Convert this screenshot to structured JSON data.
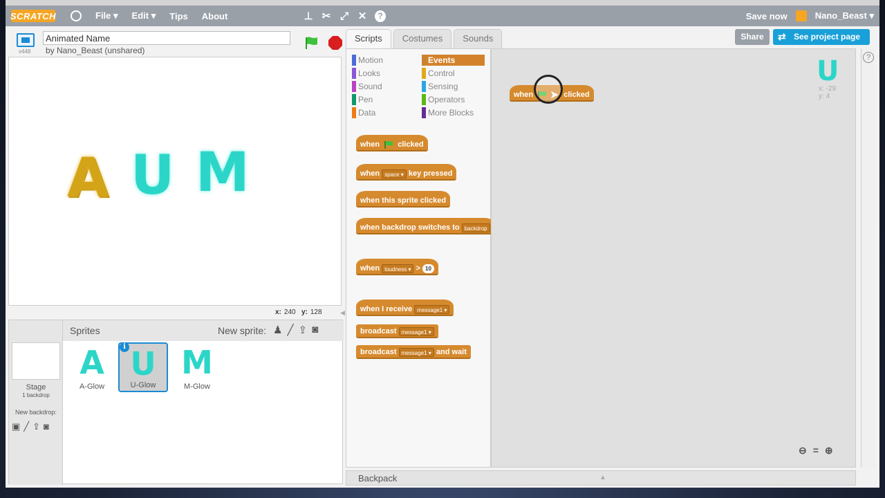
{
  "colors": {
    "menubar": "#9aa0a8",
    "block_orange": "#d68a2e",
    "accent_blue": "#1aa0d8",
    "glow_cyan": "#2bd6c8",
    "glow_gold": "#d4a418"
  },
  "menubar": {
    "logo": "SCRATCH",
    "items": [
      "File ▾",
      "Edit ▾",
      "Tips",
      "About"
    ],
    "tools": [
      "duplicate-icon",
      "delete-icon",
      "grow-icon",
      "shrink-icon",
      "help-icon"
    ],
    "save_now": "Save now",
    "user": "Nano_Beast ▾"
  },
  "stage_header": {
    "version": "v448",
    "project_title": "Animated Name",
    "byline": "by Nano_Beast (unshared)"
  },
  "stage": {
    "letters": [
      "A",
      "U",
      "M"
    ],
    "coords_x_label": "x:",
    "coords_x": "240",
    "coords_y_label": "y:",
    "coords_y": "128"
  },
  "sprites_pane": {
    "title": "Sprites",
    "new_sprite": "New sprite:",
    "stage_label": "Stage",
    "stage_sub": "1 backdrop",
    "new_backdrop": "New backdrop:",
    "sprites": [
      {
        "glyph": "A",
        "name": "A-Glow"
      },
      {
        "glyph": "U",
        "name": "U-Glow",
        "selected": true
      },
      {
        "glyph": "M",
        "name": "M-Glow"
      }
    ]
  },
  "tabs": [
    "Scripts",
    "Costumes",
    "Sounds"
  ],
  "share": "Share",
  "see_project": "See project page",
  "categories": [
    {
      "label": "Motion",
      "color": "#4a6cd4"
    },
    {
      "label": "Looks",
      "color": "#8a55d7"
    },
    {
      "label": "Sound",
      "color": "#bb42c3"
    },
    {
      "label": "Pen",
      "color": "#0e9a6c"
    },
    {
      "label": "Data",
      "color": "#ee7d16"
    },
    {
      "label": "Events",
      "color": "#c88330",
      "active": true
    },
    {
      "label": "Control",
      "color": "#e1a91a"
    },
    {
      "label": "Sensing",
      "color": "#2ca5e2"
    },
    {
      "label": "Operators",
      "color": "#5cb712"
    },
    {
      "label": "More Blocks",
      "color": "#632d99"
    }
  ],
  "blocks": {
    "when": "when",
    "clicked": "clicked",
    "key_pressed": "key pressed",
    "space": "space",
    "sprite_clicked": "when this sprite clicked",
    "backdrop_switches": "when backdrop switches to",
    "backdrop": "backdrop",
    "loudness": "loudness",
    "gt": ">",
    "ten": "10",
    "when_receive": "when I receive",
    "message1": "message1",
    "broadcast": "broadcast",
    "and_wait": "and wait"
  },
  "scripts_area": {
    "script_when": "when",
    "script_clicked": "clicked",
    "sprite_glyph": "U",
    "x": "x: -29",
    "y": "y: 4"
  },
  "backpack": "Backpack"
}
